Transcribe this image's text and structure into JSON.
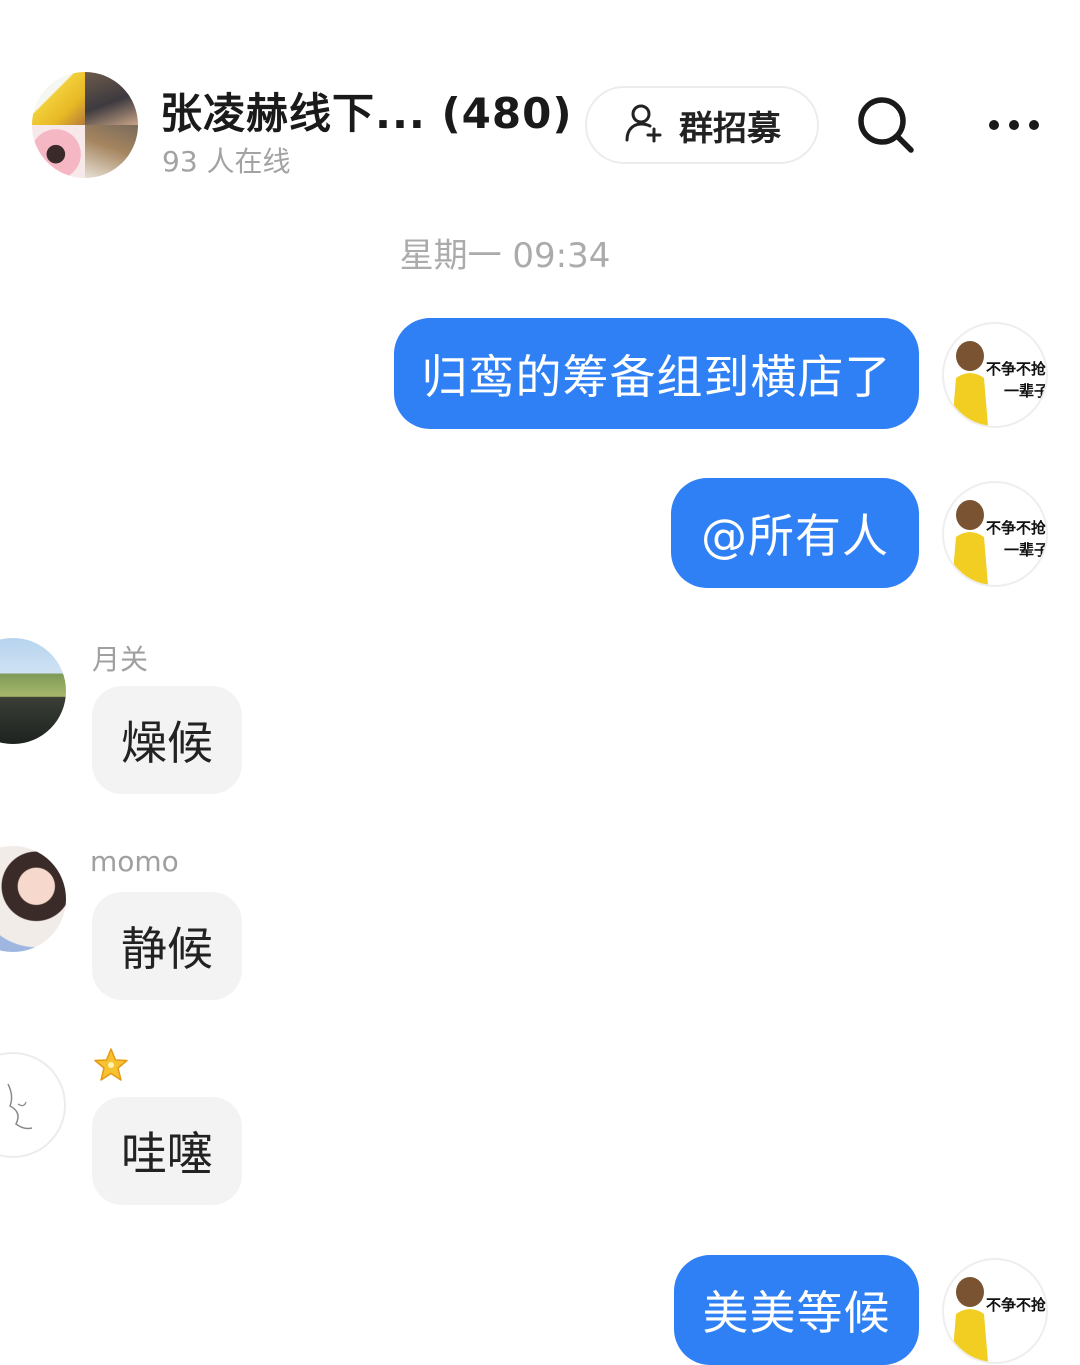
{
  "header": {
    "group_name": "张凌赫线下... (480)",
    "online_status": "93 人在线",
    "recruit_label": "群招募",
    "avatar_captions": [
      "不争不抢",
      "一辈子"
    ]
  },
  "chat": {
    "timestamp": "星期一 09:34",
    "messages": [
      {
        "direction": "out",
        "text": "归鸾的筹备组到横店了"
      },
      {
        "direction": "out",
        "text": "@所有人"
      },
      {
        "direction": "in",
        "sender": "月关",
        "text": "燥候"
      },
      {
        "direction": "in",
        "sender": "momo",
        "text": "静候"
      },
      {
        "direction": "in",
        "sender": "",
        "text": "哇噻"
      },
      {
        "direction": "out",
        "text": "美美等候"
      }
    ],
    "self_avatar_caption": [
      "不争不抢",
      "一辈子"
    ]
  },
  "colors": {
    "outgoing_bubble": "#2f80f5",
    "incoming_bubble": "#f3f3f3",
    "muted_text": "#a3a3a3"
  },
  "icons": [
    "add-user-icon",
    "search-icon",
    "more-icon",
    "star-badge-icon"
  ]
}
